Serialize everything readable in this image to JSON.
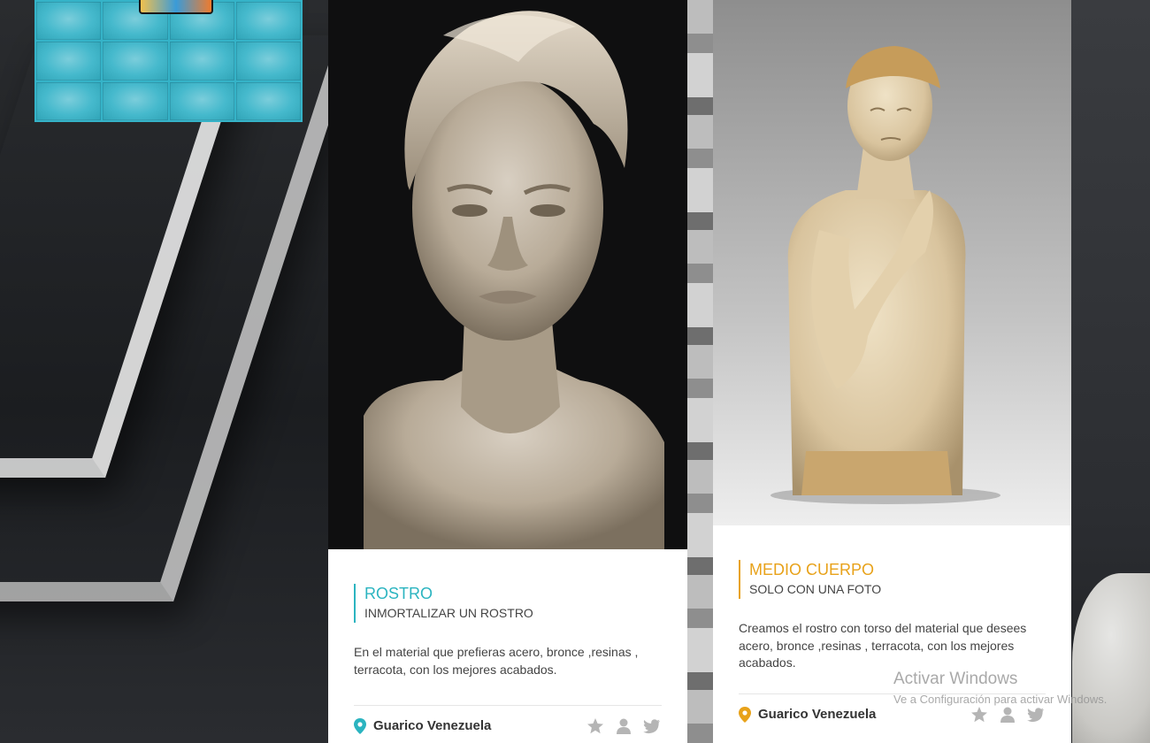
{
  "logo": {
    "tiles": 12,
    "name": "sculpture-gallery-logo"
  },
  "cards": [
    {
      "title": "ROSTRO",
      "subtitle": "INMORTALIZAR UN ROSTRO",
      "text": "En el material que prefieras acero, bronce ,resinas , terracota, con los mejores acabados.",
      "location": "Guarico Venezuela",
      "accent": "#2bb4c0",
      "icons": [
        "star-icon",
        "user-icon",
        "twitter-icon"
      ]
    },
    {
      "title": "MEDIO CUERPO",
      "subtitle": "SOLO CON UNA FOTO",
      "text": "Creamos el rostro con torso del material que desees acero, bronce ,resinas , terracota, con los mejores acabados.",
      "location": "Guarico Venezuela",
      "accent": "#e8a21a",
      "icons": [
        "star-icon",
        "user-icon",
        "twitter-icon"
      ]
    }
  ],
  "watermark": {
    "title": "Activar Windows",
    "subtitle": "Ve a Configuración para activar Windows."
  },
  "colors": {
    "teal": "#2bb4c0",
    "orange": "#e8a21a",
    "logo_bg": "#35b3c8",
    "icon_gray": "#b5b5b5"
  }
}
